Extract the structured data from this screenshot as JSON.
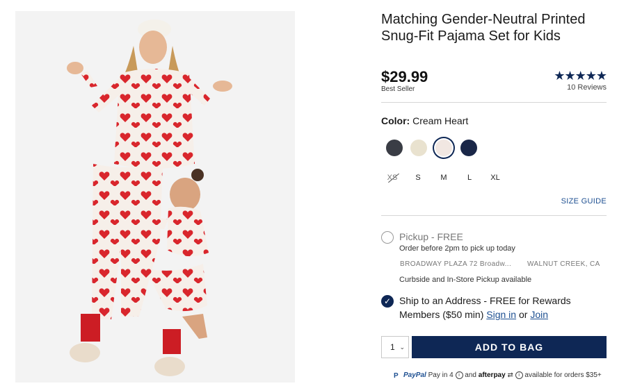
{
  "product": {
    "title": "Matching Gender-Neutral Printed Snug-Fit Pajama Set for Kids",
    "price": "$29.99",
    "badge": "Best Seller",
    "rating_stars": "★★★★★",
    "rating_value": 4.5,
    "reviews": "10 Reviews"
  },
  "color": {
    "label": "Color:",
    "selected": "Cream Heart",
    "swatches": [
      {
        "name": "dark-stripe-swatch",
        "color": "#3a3d45"
      },
      {
        "name": "dots-swatch",
        "color": "#e9e2cf"
      },
      {
        "name": "cream-heart-swatch",
        "color": "#f1e7e2",
        "selected": true
      },
      {
        "name": "navy-swatch",
        "color": "#1a2748"
      }
    ]
  },
  "sizes": [
    {
      "label": "XS",
      "available": false
    },
    {
      "label": "S",
      "available": true
    },
    {
      "label": "M",
      "available": true
    },
    {
      "label": "L",
      "available": true
    },
    {
      "label": "XL",
      "available": true
    }
  ],
  "size_guide": "SIZE GUIDE",
  "pickup": {
    "title": "Pickup - FREE",
    "note": "Order before 2pm to pick up today",
    "store": "BROADWAY PLAZA 72 Broadw...",
    "city": "WALNUT CREEK, CA",
    "curbside": "Curbside and In-Store Pickup available"
  },
  "ship": {
    "text": "Ship to an Address - FREE for Rewards Members ($50 min)",
    "sign_in": "Sign in",
    "or": "or",
    "join": "Join"
  },
  "cart": {
    "quantity": "1",
    "add_to_bag": "ADD TO BAG"
  },
  "payment": {
    "paypal": "PayPal",
    "pay_in": "Pay in 4",
    "and": "and",
    "afterpay": "afterpay",
    "available": "available for orders $35+"
  },
  "colors": {
    "navy": "#0e2755",
    "link": "#1d4f91",
    "heart_red": "#d9262c"
  }
}
